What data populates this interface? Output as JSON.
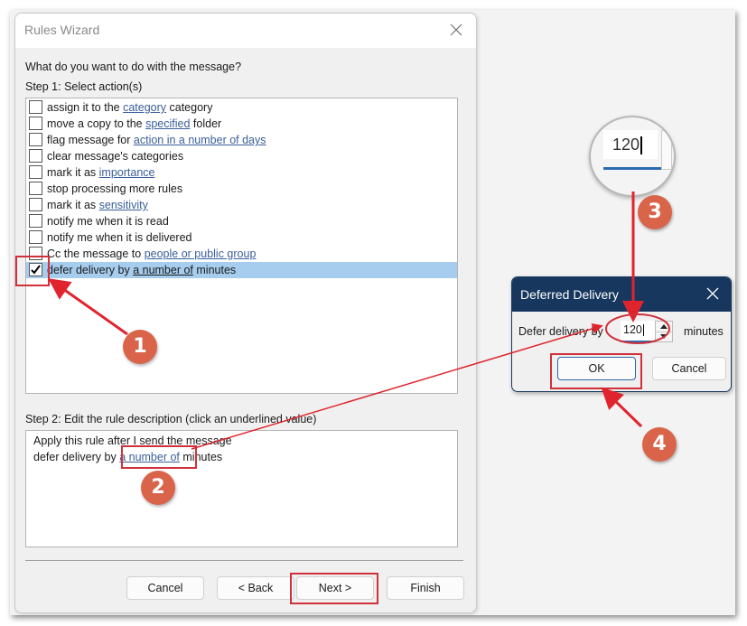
{
  "wizard": {
    "title": "Rules Wizard",
    "question": "What do you want to do with the message?",
    "step1_label": "Step 1: Select action(s)",
    "actions": [
      {
        "pre": "assign it to the ",
        "link": "category",
        "post": " category",
        "checked": false
      },
      {
        "pre": "move a copy to the ",
        "link": "specified",
        "post": " folder",
        "checked": false
      },
      {
        "pre": "flag message for ",
        "link": "action in a number of days",
        "post": "",
        "checked": false
      },
      {
        "pre": "clear message's categories",
        "link": "",
        "post": "",
        "checked": false
      },
      {
        "pre": "mark it as ",
        "link": "importance",
        "post": "",
        "checked": false
      },
      {
        "pre": "stop processing more rules",
        "link": "",
        "post": "",
        "checked": false
      },
      {
        "pre": "mark it as ",
        "link": "sensitivity",
        "post": "",
        "checked": false
      },
      {
        "pre": "notify me when it is read",
        "link": "",
        "post": "",
        "checked": false
      },
      {
        "pre": "notify me when it is delivered",
        "link": "",
        "post": "",
        "checked": false
      },
      {
        "pre": "Cc the message to ",
        "link": "people or public group",
        "post": "",
        "checked": false
      },
      {
        "pre": "defer delivery by ",
        "link": "a number of",
        "post": " minutes",
        "checked": true,
        "selected": true
      }
    ],
    "step2_label": "Step 2: Edit the rule description (click an underlined value)",
    "description": {
      "line1": "Apply this rule after I send the message",
      "line2_pre": "defer delivery by ",
      "line2_link": "a number of",
      "line2_post": " minutes"
    },
    "buttons": {
      "cancel": "Cancel",
      "back": "< Back",
      "next": "Next >",
      "finish": "Finish"
    }
  },
  "deferred_dialog": {
    "title": "Deferred Delivery",
    "label": "Defer delivery by",
    "value": "120",
    "unit": "minutes",
    "ok": "OK",
    "cancel": "Cancel"
  },
  "magnifier": {
    "value": "120"
  },
  "annotations": {
    "badges": [
      "1",
      "2",
      "3",
      "4"
    ],
    "color": "#d9644a",
    "arrow_color": "#e0242e"
  }
}
